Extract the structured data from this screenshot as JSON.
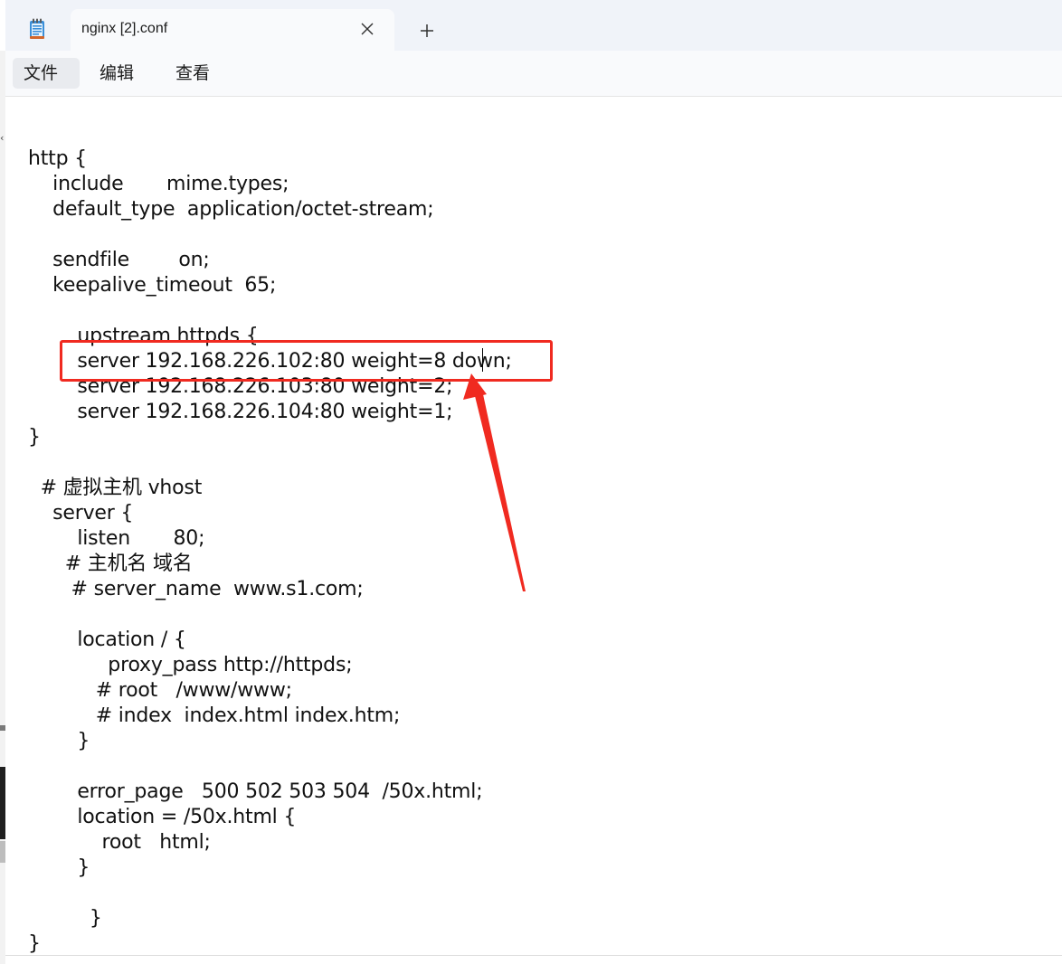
{
  "titlebar": {
    "tab_title": "nginx [2].conf",
    "new_tab_symbol": "+",
    "close_symbol": "✕",
    "app_icon": "notepad-icon"
  },
  "menu": {
    "items": [
      "文件",
      "编辑",
      "查看"
    ]
  },
  "editor": {
    "lines": [
      "http {",
      "    include       mime.types;",
      "    default_type  application/octet-stream;",
      "",
      "    sendfile        on;",
      "    keepalive_timeout  65;",
      "",
      "        upstream httpds {",
      "        server 192.168.226.102:80 weight=8 down;",
      "        server 192.168.226.103:80 weight=2;",
      "        server 192.168.226.104:80 weight=1;",
      "}",
      "",
      "  # 虚拟主机 vhost",
      "    server {",
      "        listen       80;",
      "      # 主机名 域名",
      "       # server_name  www.s1.com;",
      "",
      "        location / {",
      "             proxy_pass http://httpds;",
      "           # root   /www/www;",
      "           # index  index.html index.htm;",
      "        }",
      "",
      "        error_page   500 502 503 504  /50x.html;",
      "        location = /50x.html {",
      "            root   html;",
      "        }",
      "",
      "          }",
      "}"
    ]
  },
  "annotation": {
    "color": "#f02a20",
    "highlighted_line": "server 192.168.226.102:80 weight=8 down;"
  },
  "colors": {
    "titlebar_bg": "#f0f3f9",
    "menubar_bg": "#f9fafc",
    "editor_bg": "#ffffff",
    "accent_red": "#f02a20"
  }
}
